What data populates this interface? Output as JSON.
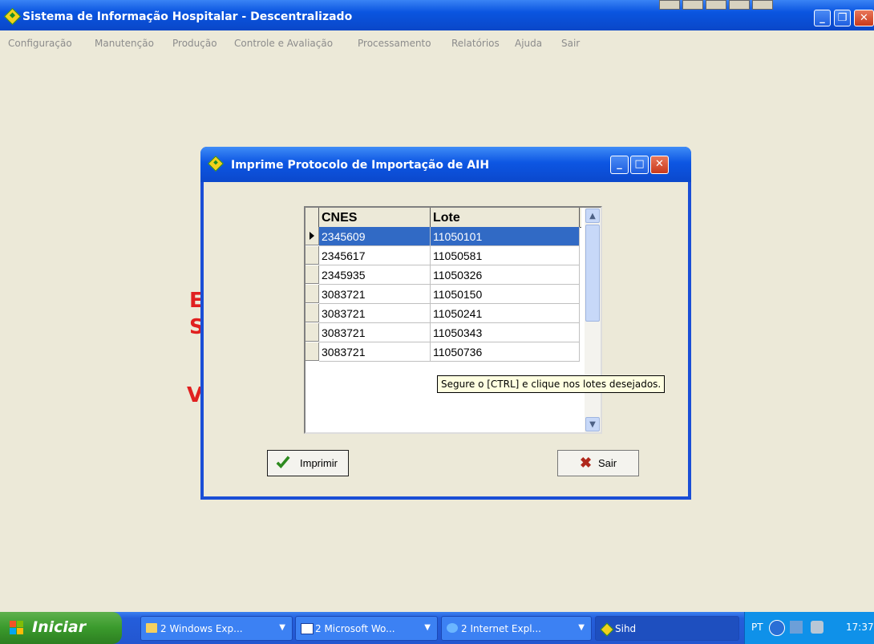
{
  "app": {
    "title": "Sistema de Informação Hospitalar - Descentralizado",
    "menu": [
      "Configuração",
      "Manutenção",
      "Produção",
      "Controle e Avaliação",
      "Processamento",
      "Relatórios",
      "Ajuda",
      "Sair"
    ]
  },
  "background_text": {
    "line1": "E",
    "line2": "S",
    "line3": "V"
  },
  "dialog": {
    "title": "Imprime Protocolo de Importação de AIH",
    "columns": [
      "CNES",
      "Lote"
    ],
    "rows": [
      {
        "cnes": "2345609",
        "lote": "11050101"
      },
      {
        "cnes": "2345617",
        "lote": "11050581"
      },
      {
        "cnes": "2345935",
        "lote": "11050326"
      },
      {
        "cnes": "3083721",
        "lote": "11050150"
      },
      {
        "cnes": "3083721",
        "lote": "11050241"
      },
      {
        "cnes": "3083721",
        "lote": "11050343"
      },
      {
        "cnes": "3083721",
        "lote": "11050736"
      }
    ],
    "tooltip": "Segure o [CTRL] e clique nos lotes desejados.",
    "print_label": "Imprimir",
    "exit_label": "Sair"
  },
  "taskbar": {
    "start": "Iniciar",
    "tasks": [
      {
        "label": "2 Windows Exp...",
        "icon": "folder-icon"
      },
      {
        "label": "2 Microsoft Wo...",
        "icon": "word-icon"
      },
      {
        "label": "2 Internet Expl...",
        "icon": "ie-icon"
      },
      {
        "label": "Sihd",
        "icon": "sihd-icon"
      }
    ],
    "lang": "PT",
    "clock": "17:37"
  },
  "colors": {
    "title_blue": "#0a55e0",
    "selection": "#316ac5",
    "red_text": "#e02020",
    "face": "#ece9d8"
  }
}
